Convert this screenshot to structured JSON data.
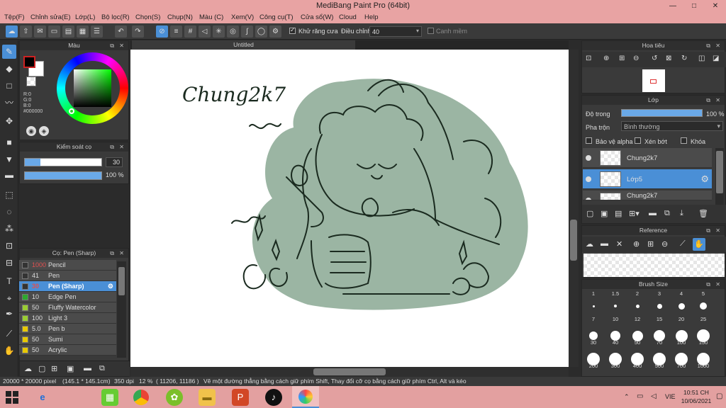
{
  "window": {
    "title": "MediBang Paint Pro (64bit)",
    "min": "—",
    "max": "□",
    "close": "✕"
  },
  "menu": [
    "Tệp(F)",
    "Chỉnh sửa(E)",
    "Lớp(L)",
    "Bộ lọc(R)",
    "Chọn(S)",
    "Chụp(N)",
    "Màu (C)",
    "Xem(V)",
    "Công cụ(T)",
    "Cửa sổ(W)",
    "Cloud",
    "Help"
  ],
  "toolbar": {
    "antialias_label": "Khử răng cưa",
    "antialias_checked": true,
    "adjust_label": "Điều chỉnh",
    "adjust_value": "40",
    "edge_label": "Canh mềm",
    "edge_checked": false
  },
  "color_panel": {
    "title": "Màu",
    "r": "R:0",
    "g": "G:0",
    "b": "B:0",
    "hex": "#000000",
    "primary_color": "#000000",
    "secondary_color": "#ffffff"
  },
  "brush_control": {
    "title": "Kiểm soát cọ",
    "size": "30",
    "size_fraction": 0.2,
    "opacity": "100 %",
    "opacity_fraction": 1.0
  },
  "brush_panel": {
    "title": "Cọ: Pen (Sharp)",
    "brushes": [
      {
        "size": "1000",
        "name": "Pencil",
        "color": "#333333",
        "sizeColor": "#e05050"
      },
      {
        "size": "41",
        "name": "Pen",
        "color": "#333333",
        "sizeColor": "#dddddd"
      },
      {
        "size": "30",
        "name": "Pen (Sharp)",
        "color": "#333333",
        "sizeColor": "#e05050",
        "selected": true
      },
      {
        "size": "10",
        "name": "Edge Pen",
        "color": "#2ea82e",
        "sizeColor": "#dddddd"
      },
      {
        "size": "50",
        "name": "Fluffy Watercolor",
        "color": "#9acd32",
        "sizeColor": "#dddddd"
      },
      {
        "size": "100",
        "name": "Light 3",
        "color": "#9acd32",
        "sizeColor": "#dddddd"
      },
      {
        "size": "5.0",
        "name": "Pen b",
        "color": "#e8c900",
        "sizeColor": "#dddddd"
      },
      {
        "size": "50",
        "name": "Sumi",
        "color": "#e8c900",
        "sizeColor": "#dddddd"
      },
      {
        "size": "50",
        "name": "Acrylic",
        "color": "#e8c900",
        "sizeColor": "#dddddd"
      }
    ]
  },
  "canvas": {
    "tab_title": "Untitled",
    "text": "Chung2k7",
    "fill_color": "#9bb5a3",
    "line_color": "#1a2a1f"
  },
  "navigator": {
    "title": "Hoa tiêu"
  },
  "layer_panel": {
    "title": "Lớp",
    "opacity_label": "Độ trong",
    "opacity_value": "100 %",
    "opacity_fraction": 1.0,
    "blend_label": "Pha trộn",
    "blend_value": "Bình thường",
    "protect_alpha": "Bảo vệ alpha",
    "clipping": "Xén bớt",
    "lock": "Khóa",
    "layers": [
      {
        "name": "Chung2k7",
        "selected": false
      },
      {
        "name": "Lớp5",
        "selected": true
      },
      {
        "name": "Chung2k7",
        "selected": false
      }
    ]
  },
  "reference": {
    "title": "Reference"
  },
  "brush_size": {
    "title": "Brush Size",
    "headers": [
      "1",
      "1.5",
      "2",
      "3",
      "4",
      "5"
    ],
    "rows": [
      [
        "7",
        "10",
        "12",
        "15",
        "20",
        "25"
      ],
      [
        "30",
        "40",
        "50",
        "70",
        "100",
        "150"
      ],
      [
        "200",
        "300",
        "400",
        "500",
        "700",
        "1000"
      ]
    ]
  },
  "status": {
    "canvas_size": "20000 * 20000 pixel",
    "physical": "(145.1 * 145.1cm)",
    "dpi": "350 dpi",
    "zoom": "12 %",
    "cursor": "( 11206, 11186 )",
    "hint": "Vẽ một đường thẳng bằng cách giữ phím Shift, Thay đổi cỡ cọ bằng cách giữ phím Ctrl, Alt và kéo"
  },
  "taskbar": {
    "lang": "VIE",
    "time": "10:51 CH",
    "date": "10/06/2021"
  }
}
